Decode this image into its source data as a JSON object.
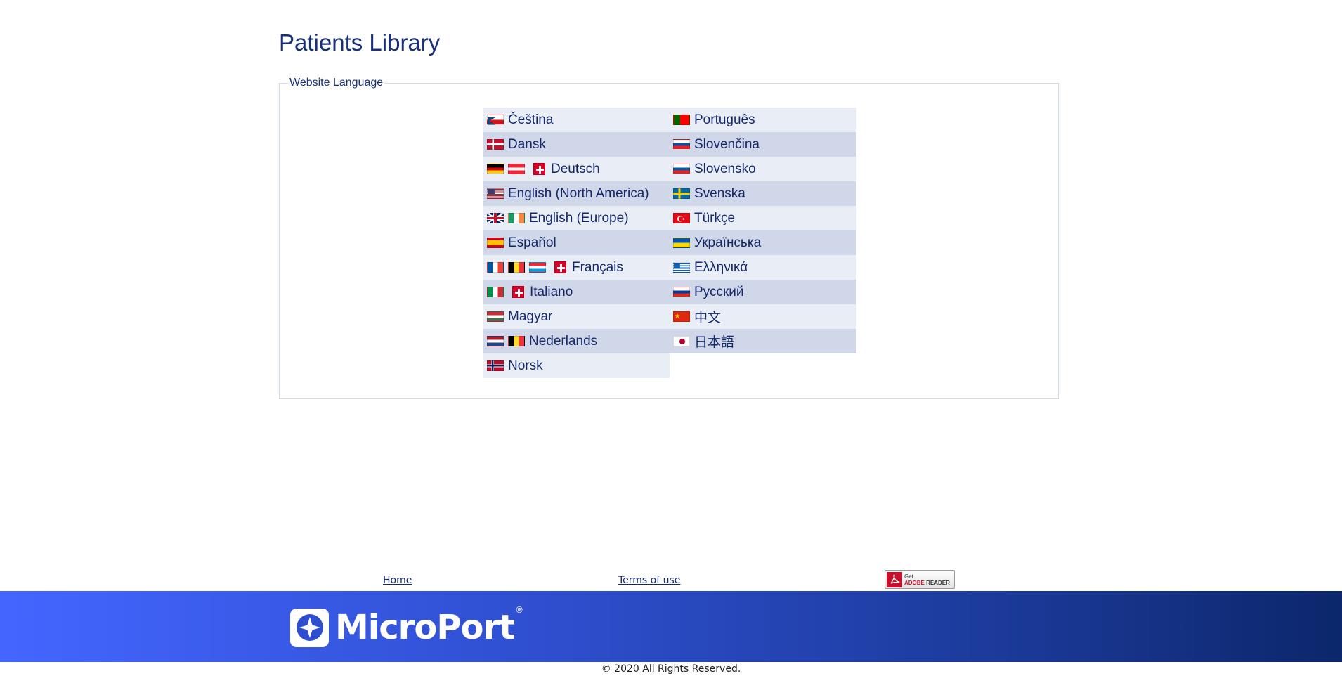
{
  "page": {
    "title": "Patients Library"
  },
  "language_box": {
    "legend": "Website Language",
    "languages": [
      {
        "label": "Čeština",
        "flags": [
          "cz"
        ]
      },
      {
        "label": "Português",
        "flags": [
          "pt"
        ]
      },
      {
        "label": "Dansk",
        "flags": [
          "dk"
        ]
      },
      {
        "label": "Slovenčina",
        "flags": [
          "sk"
        ]
      },
      {
        "label": "Deutsch",
        "flags": [
          "de",
          "at",
          "ch"
        ]
      },
      {
        "label": "Slovensko",
        "flags": [
          "si"
        ]
      },
      {
        "label": "English (North America)",
        "flags": [
          "us"
        ]
      },
      {
        "label": "Svenska",
        "flags": [
          "se"
        ]
      },
      {
        "label": "English (Europe)",
        "flags": [
          "gb",
          "ie"
        ]
      },
      {
        "label": "Türkçe",
        "flags": [
          "tr"
        ]
      },
      {
        "label": "Español",
        "flags": [
          "es"
        ]
      },
      {
        "label": "Українська",
        "flags": [
          "ua"
        ]
      },
      {
        "label": "Français",
        "flags": [
          "fr",
          "be",
          "lu",
          "ch"
        ]
      },
      {
        "label": "Ελληνικά",
        "flags": [
          "gr"
        ]
      },
      {
        "label": "Italiano",
        "flags": [
          "it",
          "ch"
        ]
      },
      {
        "label": "Русский",
        "flags": [
          "ru"
        ]
      },
      {
        "label": "Magyar",
        "flags": [
          "hu"
        ]
      },
      {
        "label": "中文",
        "flags": [
          "cn"
        ]
      },
      {
        "label": "Nederlands",
        "flags": [
          "nl",
          "be"
        ]
      },
      {
        "label": "日本語",
        "flags": [
          "jp"
        ]
      },
      {
        "label": "Norsk",
        "flags": [
          "no"
        ]
      }
    ]
  },
  "footer": {
    "links": [
      {
        "label": "Home"
      },
      {
        "label": "Terms of use"
      }
    ],
    "adobe_badge": {
      "line1": "Get",
      "line2a": "ADOBE",
      "line2b": " READER",
      "icon": "adobe-pdf-icon"
    },
    "brand": {
      "name": "MicroPort",
      "reg": "®",
      "icon": "microport-star-icon"
    },
    "copyright": "© 2020 All Rights Reserved."
  },
  "colors": {
    "title": "#17307a",
    "row_light": "#e8edf6",
    "row_dark": "#cfd7e8",
    "band_start": "#4466ff",
    "band_end": "#0c276b"
  }
}
